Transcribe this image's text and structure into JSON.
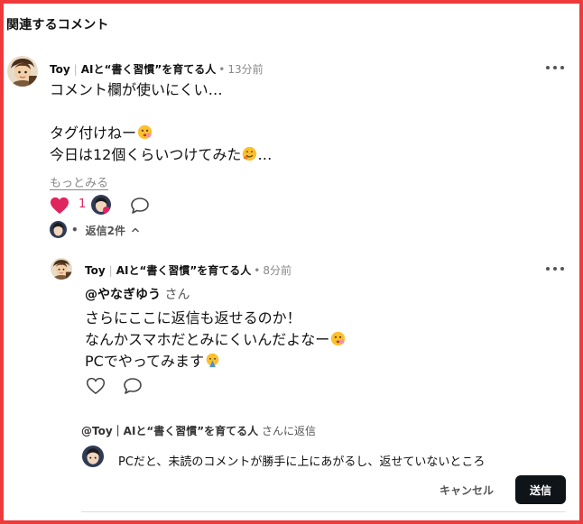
{
  "section": {
    "title": "関連するコメント"
  },
  "comment": {
    "author_name": "Toy",
    "author_tagline": "AIと“書く習慣”を育てる人",
    "time": "13分前",
    "line1": "コメント欄が使いにくい…",
    "line2": "タグ付けねー",
    "line3_text": "今日は12個くらいつけてみた",
    "line3_tail": "…",
    "more_label": "もっとみる",
    "likes": "1",
    "replies_label": "返信2件",
    "bullet": "•"
  },
  "reply": {
    "author_name": "Toy",
    "author_tagline": "AIと“書く習慣”を育てる人",
    "time": "8分前",
    "mention": "@やなぎゆう",
    "mention_suffix": "さん",
    "line1": "さらにここに返信も返せるのか！",
    "line2": "なんかスマホだとみにくいんだよなー",
    "line3": "PCでやってみます"
  },
  "composer": {
    "reply_to_name": "@Toy｜AIと“書く習慣”を育てる人",
    "reply_to_suffix": "さんに返信",
    "value": "PCだと、未読のコメントが勝手に上にあがるし、返せていないところ",
    "cancel_label": "キャンセル",
    "send_label": "送信"
  },
  "colors": {
    "frame": "#ee3a3a",
    "like": "#e0245e",
    "send_bg": "#0f1419"
  },
  "icons": [
    "heart-filled-icon",
    "heart-outline-icon",
    "comment-icon",
    "more-icon",
    "chevron-up-icon",
    "thinking-emoji-icon",
    "smile-emoji-icon",
    "pray-emoji-icon"
  ]
}
